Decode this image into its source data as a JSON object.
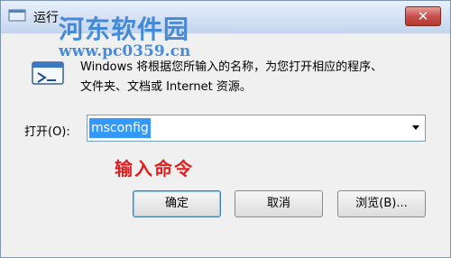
{
  "window": {
    "title": "运行"
  },
  "watermark": {
    "name": "河东软件园",
    "url": "www.pc0359.cn"
  },
  "description": {
    "line1": "Windows 将根据您所输入的名称，为您打开相应的程序、",
    "line2": "文件夹、文档或 Internet 资源。"
  },
  "open_field": {
    "label": "打开(O):",
    "value": "msconfig"
  },
  "annotation": "输入命令",
  "buttons": {
    "ok": "确定",
    "cancel": "取消",
    "browse": "浏览(B)..."
  },
  "colors": {
    "hint": "#e02020",
    "selection": "#3399ff",
    "close": "#c75050"
  },
  "icons": {
    "title": "run-icon",
    "dialog": "run-program-icon",
    "close": "close-icon",
    "dropdown": "chevron-down-icon"
  }
}
